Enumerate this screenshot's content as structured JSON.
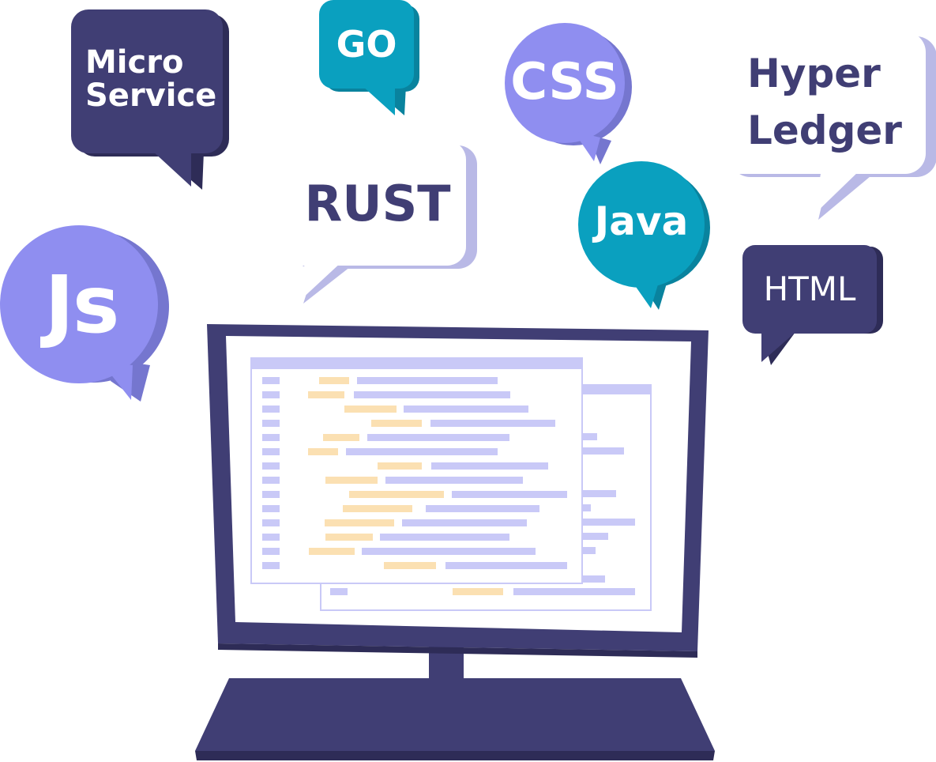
{
  "palette": {
    "navy": "#403e74",
    "navy_shadow": "#2e2c57",
    "periwinkle": "#8f8ef0",
    "periwinkle_shadow": "#7576cf",
    "teal": "#0aa0bf",
    "teal_shadow": "#09839e",
    "white": "#ffffff",
    "white_shadow": "#b9b9e6",
    "code_keyword": "#fbe0b2",
    "code_text": "#c9c9f7"
  },
  "bubbles": {
    "micro_service": {
      "lines": [
        "Micro",
        "Service"
      ],
      "style": "navy"
    },
    "go": {
      "lines": [
        "GO"
      ],
      "style": "teal"
    },
    "css": {
      "lines": [
        "CSS"
      ],
      "style": "periwinkle"
    },
    "hyper_ledger": {
      "lines": [
        "Hyper",
        "Ledger"
      ],
      "style": "white"
    },
    "rust": {
      "lines": [
        "RUST"
      ],
      "style": "white"
    },
    "java": {
      "lines": [
        "Java"
      ],
      "style": "teal"
    },
    "js": {
      "lines": [
        "Js"
      ],
      "style": "periwinkle"
    },
    "html": {
      "lines": [
        "HTML"
      ],
      "style": "navy"
    }
  },
  "illustration": {
    "subject": "desktop-monitor",
    "screen_content": "code-editor-windows"
  }
}
